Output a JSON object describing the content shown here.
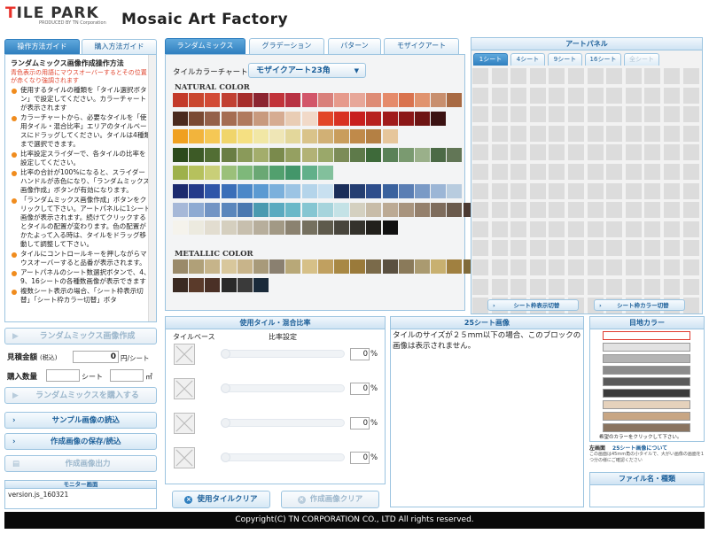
{
  "header": {
    "logo_text": "TILE PARK",
    "logo_sub": "PRODUCED BY TN Corporation",
    "app_title": "Mosaic Art Factory"
  },
  "left_tabs": [
    "操作方法ガイド",
    "購入方法ガイド"
  ],
  "guide": {
    "heading": "ランダムミックス画像作成操作方法",
    "note": "青色表示の用語にマウスオーバーするとその位置が赤くなり強調されます",
    "items": [
      "使用するタイルの種類を「タイル選択ボタン」で設定してください。カラーチャートが表示されます",
      "カラーチャートから、必要なタイルを「使用タイル・混合比率」エリアのタイルベースにドラッグしてください。タイルは4種類まで選択できます。",
      "比率設定スライダーで、各タイルの比率を設定してください。",
      "比率の合計が100%になると、スライダーハンドルが赤色になり、「ランダムミックス画像作成」ボタンが有効になります。",
      "「ランダムミックス画像作成」ボタンをクリックして下さい。アートパネルに1シート画像が表示されます。続けてクリックするとタイルの配置が変わります。色の配置がかたよって入る時は、タイルをドラッグ移動して調整して下さい。",
      "タイルにコントロールキーを押しながらマウスオーバーすると品番が表示されます。",
      "アートパネルのシート数選択ボタンで、4、9、16シートの各種数画像が表示できます",
      "複数シート表示の場合、「シート枠表示切替」「シート枠カラー切替」ボタ"
    ]
  },
  "left_controls": {
    "create_button": "ランダムミックス画像作成",
    "estimate_label": "見積金額",
    "estimate_sub": "(税込)",
    "estimate_value": "0",
    "estimate_unit": "円/シート",
    "qty_label": "購入数量",
    "qty_unit1": "シート",
    "qty_unit2": "㎡",
    "buy_button": "ランダムミックスを購入する",
    "sample_button": "サンプル画像の読込",
    "save_button": "作成画像の保存/読込",
    "output_button": "作成画像出力",
    "monitor_title": "モニター画面",
    "monitor_text": "version.js_160321"
  },
  "center_tabs": [
    "ランダムミックス",
    "グラデーション",
    "パターン",
    "モザイクアート"
  ],
  "chart": {
    "label": "タイルカラーチャート",
    "selected": "モザイクアート23角",
    "natural_title": "NATURAL COLOR",
    "metallic_title": "METALLIC COLOR",
    "natural_rows": [
      [
        "#c33a2a",
        "#c9472f",
        "#d24b36",
        "#c14032",
        "#a62d2b",
        "#8c2430",
        "#c1333a",
        "#b83243",
        "#d2566a",
        "#d9807b",
        "#e69a8c",
        "#e7a799",
        "#de8c76",
        "#e58b6b",
        "#d9734e",
        "#e0936e",
        "#c88f6e",
        "#a86a43"
      ],
      [
        "#4a2a1e",
        "#7a4a33",
        "#94614a",
        "#a56d52",
        "#b07a5e",
        "#c89a7e",
        "#d6ac92",
        "#e9cdb5",
        "#f1d9c8",
        "#e24628",
        "#d83223",
        "#c81f1e",
        "#b7211f",
        "#a01b1b",
        "#8b1717",
        "#6e1413",
        "#3b1212"
      ],
      [
        "#f0a020",
        "#f2b43c",
        "#f5c855",
        "#f0d56b",
        "#f5e082",
        "#f1e7a5",
        "#efe6b6",
        "#e3d79b",
        "#d9c38a",
        "#d1b075",
        "#c99d5c",
        "#c08a4a",
        "#b48044",
        "#e6c69b"
      ],
      [
        "#2c4a1c",
        "#3d5a26",
        "#526e34",
        "#6a7e44",
        "#8a9a5a",
        "#a3ad6c",
        "#7a8a4c",
        "#95a061",
        "#b2b276",
        "#9aa86a",
        "#7c8c58",
        "#5e7a4a",
        "#3e6a3a",
        "#5a8258",
        "#7a9a70",
        "#9ab08a",
        "#4c6a46",
        "#627656"
      ],
      [
        "#9eb14b",
        "#b6c15d",
        "#c9cf78",
        "#9bc07a",
        "#7eb87a",
        "#6aa874",
        "#52a06e",
        "#43966a",
        "#62b08a",
        "#82c09c"
      ],
      [
        "#1c2a6e",
        "#243a8a",
        "#2f55a8",
        "#3a6eb8",
        "#4c88c8",
        "#5b9ad2",
        "#7bb0dc",
        "#9cc4e4",
        "#b4d4ea",
        "#c8e0f0",
        "#1a2e5a",
        "#243e72",
        "#2e4e8c",
        "#3a629e",
        "#5a7eb4",
        "#7a9ac6",
        "#9cb6d6",
        "#b8ccdf"
      ],
      [
        "#a6b8d8",
        "#8eaad2",
        "#7294c4",
        "#5a86bc",
        "#4a78b0",
        "#4a9ab0",
        "#5aaac0",
        "#6ab8c8",
        "#86c6d2",
        "#a6d4dc",
        "#c4e2e6",
        "#d4d0c0",
        "#c8bca8",
        "#bcaa94",
        "#a8947e",
        "#94806c",
        "#7e6c5c",
        "#6a5a4c",
        "#4c3a32",
        "#2a2a3a"
      ],
      [
        "#f5f3ec",
        "#eceadf",
        "#e2ddd0",
        "#d5cfbf",
        "#c7bfae",
        "#b7ae9c",
        "#a29985",
        "#8b8270",
        "#75705f",
        "#5e5a4c",
        "#48453c",
        "#34322c",
        "#22201c",
        "#111111"
      ]
    ],
    "metallic_rows": [
      [
        "#9a8a6a",
        "#b0a078",
        "#c6b48a",
        "#d8c79c",
        "#c8b48a",
        "#a89a7a",
        "#8a8070",
        "#b8a878",
        "#d6c088",
        "#c0a060",
        "#a88844",
        "#9a7a3a",
        "#7a6a4a",
        "#5a5040",
        "#8a7a5a",
        "#aa9a70",
        "#c8b070",
        "#a08040",
        "#806a3a",
        "#5a4a2a",
        "#3a3020",
        "#7a6a50",
        "#9a8a60",
        "#b08a3a",
        "#c09a48"
      ],
      [
        "#3a2a22",
        "#5a3a2a",
        "#4a3026",
        "#2a2a2a",
        "#3a3a3a",
        "#1a2a3a"
      ]
    ]
  },
  "art_panel": {
    "title": "アートパネル",
    "sheet_tabs": [
      "1シート",
      "4シート",
      "9シート",
      "16シート",
      "全シート"
    ],
    "btn_frame": "シート枠表示切替",
    "btn_frame_color": "シート枠カラー切替"
  },
  "mix": {
    "title": "使用タイル・混合比率",
    "col1": "タイルベース",
    "col2": "比率設定",
    "values": [
      "0",
      "0",
      "0",
      "0"
    ],
    "unit": "%"
  },
  "sheet25": {
    "title": "25シート画像",
    "text": "タイルのサイズが２５ｍｍ以下の場合、このブロックの画像は表示されません。"
  },
  "grout": {
    "title": "目地カラー",
    "colors": [
      "#ffffff",
      "#e2e2e2",
      "#b4b4b4",
      "#8c8c8c",
      "#5a5a5a",
      "#3a3a3a",
      "#e6d2bc",
      "#c8a684",
      "#8a7460"
    ],
    "hint": "希望のカラーをクリックして下さい。"
  },
  "about": {
    "label": "左画面",
    "title": "25シート画像について",
    "text": "この画面は45mm角の小タイルで、大がい画像の画面を1つ分の様にご確認ください"
  },
  "file_panel": {
    "title": "ファイル名・種類"
  },
  "bottom_buttons": {
    "clear_tiles": "使用タイルクリア",
    "clear_image": "作成画像クリア"
  },
  "footer": {
    "copyright": "Copyright(C) TN CORPORATION CO., LTD All rights reserved."
  }
}
